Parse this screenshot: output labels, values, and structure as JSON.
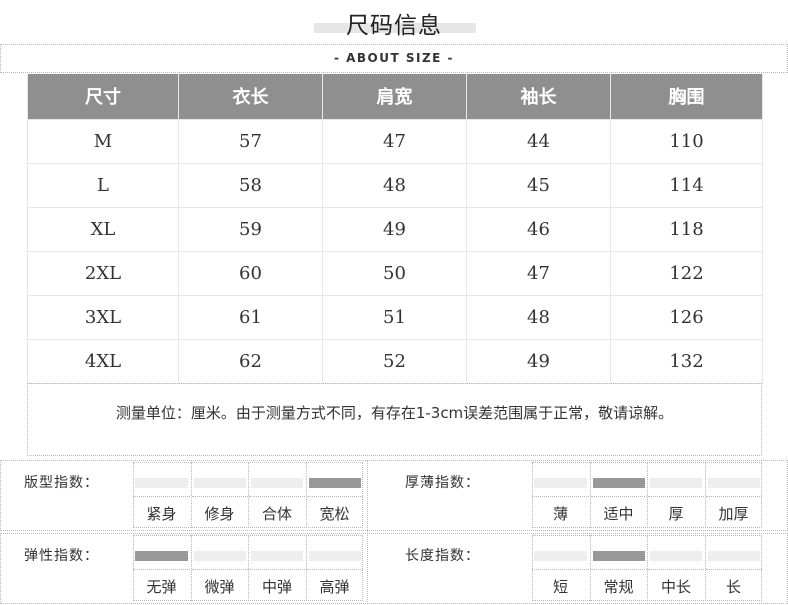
{
  "header": {
    "title": "尺码信息",
    "subtitle": "- ABOUT SIZE -"
  },
  "size_table": {
    "columns": [
      "尺寸",
      "衣长",
      "肩宽",
      "袖长",
      "胸围"
    ],
    "rows": [
      [
        "M",
        "57",
        "47",
        "44",
        "110"
      ],
      [
        "L",
        "58",
        "48",
        "45",
        "114"
      ],
      [
        "XL",
        "59",
        "49",
        "46",
        "118"
      ],
      [
        "2XL",
        "60",
        "50",
        "47",
        "122"
      ],
      [
        "3XL",
        "61",
        "51",
        "48",
        "126"
      ],
      [
        "4XL",
        "62",
        "52",
        "49",
        "132"
      ]
    ]
  },
  "note": "测量单位：厘米。由于测量方式不同，有存在1-3cm误差范围属于正常，敬请谅解。",
  "indices": {
    "fit": {
      "label": "版型指数：",
      "options": [
        "紧身",
        "修身",
        "合体",
        "宽松"
      ],
      "selected": "宽松"
    },
    "thickness": {
      "label": "厚薄指数：",
      "options": [
        "薄",
        "适中",
        "厚",
        "加厚"
      ],
      "selected": "适中"
    },
    "elasticity": {
      "label": "弹性指数：",
      "options": [
        "无弹",
        "微弹",
        "中弹",
        "高弹"
      ],
      "selected": "无弹"
    },
    "length": {
      "label": "长度指数：",
      "options": [
        "短",
        "常规",
        "中长",
        "长"
      ],
      "selected": "常规"
    }
  }
}
